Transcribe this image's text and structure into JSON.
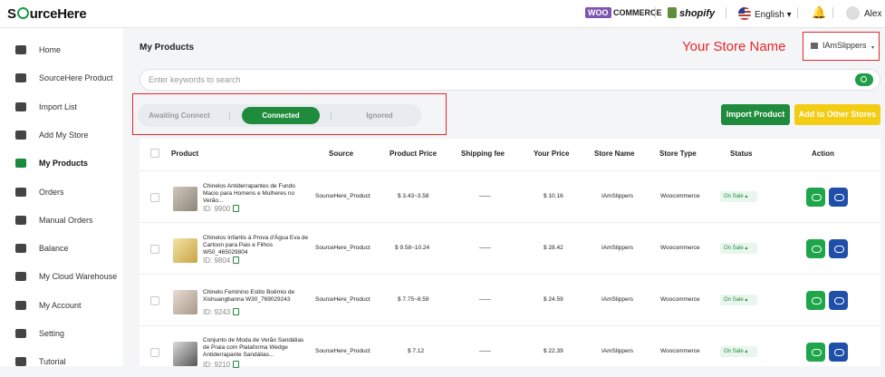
{
  "brand": {
    "logo_prefix": "S",
    "logo_suffix": "urceHere"
  },
  "topbar": {
    "woo_w": "WOO",
    "woo_label": "COMMERCE",
    "shopify_label": "shopify",
    "language": "English",
    "language_caret": "▾",
    "user": "Alex",
    "bell_icon": "🔔"
  },
  "sidebar": {
    "items": [
      {
        "label": "Home",
        "icon": "home-icon"
      },
      {
        "label": "SourceHere Product",
        "icon": "product-box-icon"
      },
      {
        "label": "Import List",
        "icon": "clipboard-icon"
      },
      {
        "label": "Add My Store",
        "icon": "store-icon"
      },
      {
        "label": "My Products",
        "icon": "grid-icon",
        "active": true
      },
      {
        "label": "Orders",
        "icon": "cart-icon"
      },
      {
        "label": "Manual Orders",
        "icon": "manual-order-icon"
      },
      {
        "label": "Balance",
        "icon": "wallet-icon"
      },
      {
        "label": "My Cloud Warehouse",
        "icon": "cloud-icon"
      },
      {
        "label": "My Account",
        "icon": "user-icon"
      },
      {
        "label": "Setting",
        "icon": "gear-icon"
      },
      {
        "label": "Tutorial",
        "icon": "question-icon"
      }
    ]
  },
  "page": {
    "title": "My Products",
    "store_name_annotation": "Your Store Name",
    "store_select_value": "IAmSlippers",
    "search_placeholder": "Enter keywords to search"
  },
  "tabs": [
    {
      "label": "Awaiting Connect"
    },
    {
      "label": "Connected",
      "active": true
    },
    {
      "label": "Ignored"
    }
  ],
  "buttons": {
    "import": "Import Product",
    "add_other": "Add to Other Stores"
  },
  "table": {
    "headers": [
      "Product",
      "Source",
      "Product Price",
      "Shipping fee",
      "Your Price",
      "Store Name",
      "Store Type",
      "Status",
      "Action"
    ],
    "rows": [
      {
        "name": "Chinelos Antiderrapantes de Fundo Macio para Homens e Mulheres no Verão...",
        "id": "ID: 9900",
        "source": "SourceHere_Product",
        "price": "$ 3.43~3.58",
        "shipping": "——",
        "your_price": "$ 10.16",
        "store": "IAmSlippers",
        "type": "Woocommerce",
        "status": "On Sale"
      },
      {
        "name": "Chinelos Infantis à Prova d'Água Eva de Cartoon para Pais e Filhos W50_465029804",
        "id": "ID: 9804",
        "source": "SourceHere_Product",
        "price": "$ 9.58~10.24",
        "shipping": "——",
        "your_price": "$ 28.42",
        "store": "IAmSlippers",
        "type": "Woocommerce",
        "status": "On Sale"
      },
      {
        "name": "Chinelo Feminino Estilo Boêmio de Xishuangbanna W30_769029243",
        "id": "ID: 9243",
        "source": "SourceHere_Product",
        "price": "$ 7.75~8.59",
        "shipping": "——",
        "your_price": "$ 24.59",
        "store": "IAmSlippers",
        "type": "Woocommerce",
        "status": "On Sale"
      },
      {
        "name": "Conjunto de Moda de Verão Sandálias de Praia com Plataforma Wedge Antiderrapante Sandálias...",
        "id": "ID: 9210",
        "source": "SourceHere_Product",
        "price": "$ 7.12",
        "shipping": "——",
        "your_price": "$ 22.39",
        "store": "IAmSlippers",
        "type": "Woocommerce",
        "status": "On Sale"
      }
    ]
  },
  "colors": {
    "primary": "#1f8b3c",
    "accent_yellow": "#f2cd14",
    "annotation_red": "#e8262b",
    "cloud_blue": "#1f4fa8"
  }
}
